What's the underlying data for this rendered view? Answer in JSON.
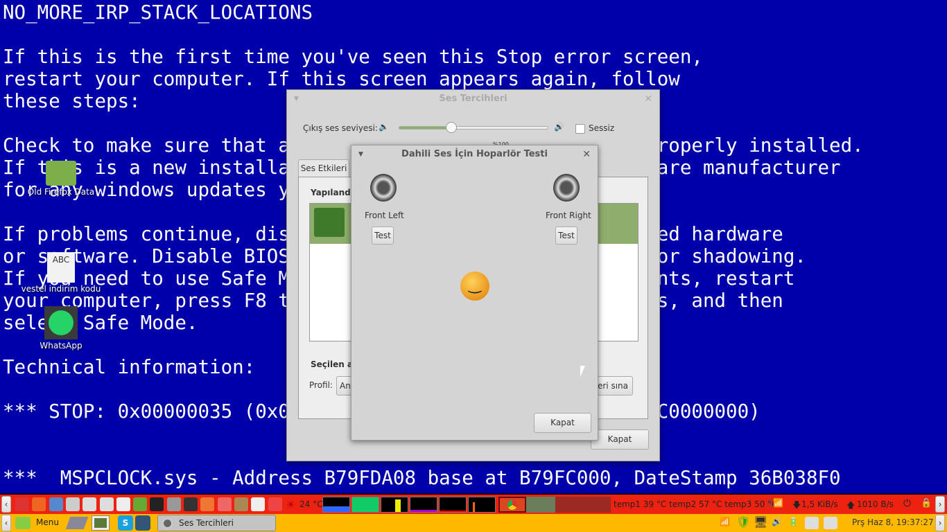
{
  "bsod": {
    "lines": [
      "NO_MORE_IRP_STACK_LOCATIONS",
      "",
      "If this is the first time you've seen this Stop error screen,",
      "restart your computer. If this screen appears again, follow",
      "these steps:",
      "",
      "Check to make sure that any new hardware or software is properly installed.",
      "If this is a new installation, ask your hardware or software manufacturer",
      "for any windows updates you might need.",
      "",
      "If problems continue, disable or remove any newly installed hardware",
      "or software. Disable BIOS memory options such as caching or shadowing.",
      "If you need to use Safe Mode to remove or disable components, restart",
      "your computer, press F8 to select Advanced Startup Options, and then",
      "select Safe Mode.",
      "",
      "Technical information:",
      "",
      "*** STOP: 0x00000035 (0x00000000,0xF7A1E000,0xC0000000,0xC0000000)",
      "",
      "",
      "***  MSPCLOCK.sys - Address B79FDA08 base at B79FC000, DateStamp 36B038F0"
    ]
  },
  "desktop": {
    "icons": [
      {
        "label": "Old Firefox Data",
        "icon": "folder-icon"
      },
      {
        "label": "vestel indirim kodu",
        "icon": "text-file-icon",
        "glyph": "ABC"
      },
      {
        "label": "WhatsApp",
        "icon": "whatsapp-icon"
      }
    ]
  },
  "sound_prefs": {
    "title": "Ses Tercihleri",
    "volume_label": "Çıkış ses seviyesi:",
    "volume_percent": 35,
    "volume_mark": "%100",
    "mute_label": "Sessiz",
    "muted": false,
    "tab": "Ses Etkileri",
    "section_configured": "Yapılandı",
    "section_selected": "Seçilen ay",
    "profile_label": "Profil:",
    "profile_value": "An",
    "test_speakers": "leri sına",
    "close": "Kapat"
  },
  "speaker_test": {
    "title": "Dahili Ses İçin Hoparlör Testi",
    "left": "Front Left",
    "right": "Front Right",
    "test": "Test",
    "close": "Kapat"
  },
  "panel_top": {
    "weather": "24 °C",
    "temps": "temp1 39 °C temp2 57 °C temp3 50 °C",
    "down": "1,5 KiB/s",
    "up": "1010 B/s",
    "colors": {
      "bg": "#ee2211"
    }
  },
  "panel_bottom": {
    "menu": "Menu",
    "task": "Ses Tercihleri",
    "clock": "Prş Haz  8, 19:37:27",
    "colors": {
      "bg": "#ffb800"
    }
  }
}
